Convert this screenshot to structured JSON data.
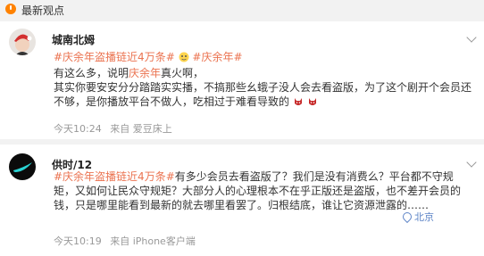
{
  "header": {
    "title": "最新观点"
  },
  "posts": [
    {
      "username": "城南北姆",
      "title_line": {
        "tag1": "#庆余年盗播链近4万条#",
        "tag2": "#庆余年#"
      },
      "body_lines": [
        {
          "prefix": "有这么多，说明",
          "highlight": "庆余年",
          "suffix": "真火啊，"
        },
        {
          "text": "其实你要安安分分踏踏实实播，不搞那些幺蛾子没人会去看盗版，为了这个剧开个会员还"
        },
        {
          "text": "不够，是你播放平台不做人，吃相过于难看导致的"
        }
      ],
      "time": "今天10:24",
      "source": "来自 爱豆床上"
    },
    {
      "username": "供时/12",
      "title_line": {
        "tag1": "#庆余年盗播链近4万条#",
        "text": "有多少会员去看盗版了？我们是没有消费么？平台都不守规"
      },
      "body_lines": [
        {
          "text": "矩，又如何让民众守规矩？大部分人的心理根本不在乎正版还是盗版，也不差开会员的"
        },
        {
          "text": "钱，只是哪里能看到最新的就去哪里看罢了。归根结底，谁让它资源泄露的……"
        }
      ],
      "location": "北京",
      "time": "今天10:19",
      "source": "来自 iPhone客户端"
    }
  ]
}
